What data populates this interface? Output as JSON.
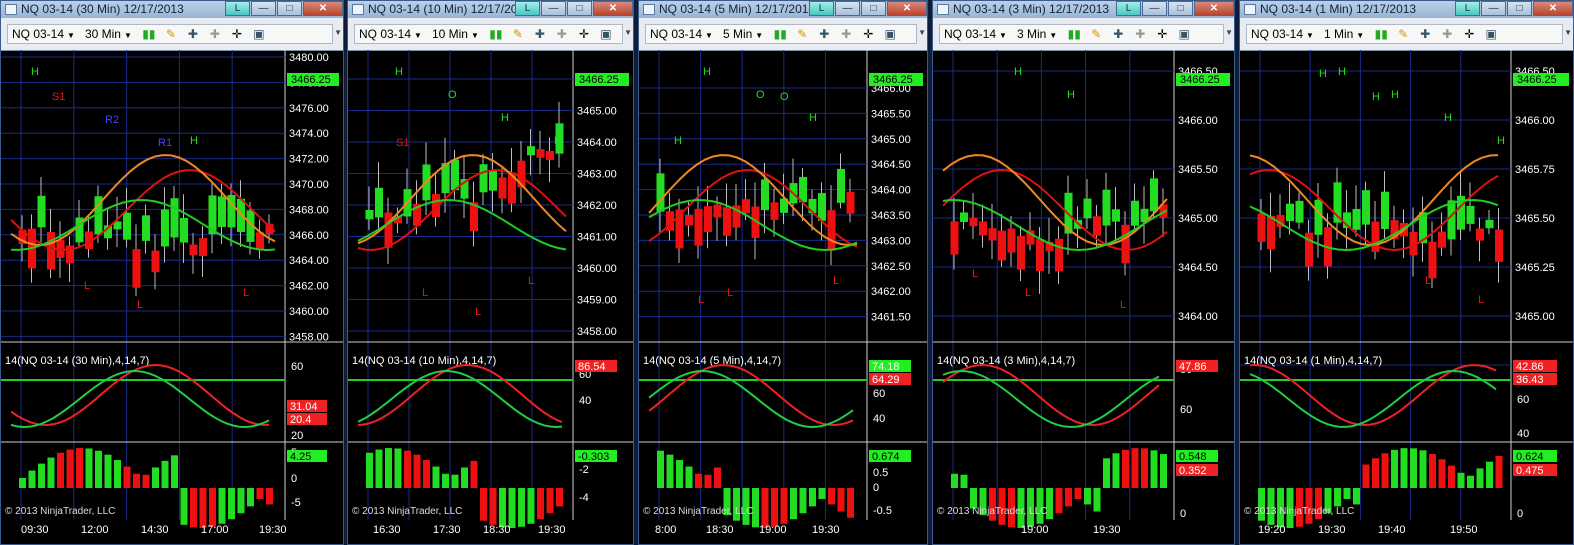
{
  "windows": [
    {
      "title": "NQ 03-14 (30 Min)  12/17/2013",
      "instrument": "NQ 03-14",
      "interval": "30 Min",
      "price_ticks": [
        "3480.00",
        "3478.00",
        "3476.00",
        "3474.00",
        "3472.00",
        "3470.00",
        "3468.00",
        "3466.00",
        "3464.00",
        "3462.00",
        "3460.00",
        "3458.00"
      ],
      "price_marker": "3466.25",
      "stoch_label": "14(NQ 03-14 (30 Min),4,14,7)",
      "stoch_ticks": [
        "60",
        "40",
        "20"
      ],
      "stoch_markers": [
        "31.04",
        "20.4"
      ],
      "macd_ticks": [
        "5",
        "0",
        "-5"
      ],
      "macd_marker": "4.25",
      "copyright": "© 2013 NinjaTrader, LLC",
      "time_ticks": [
        "09:30",
        "12:00",
        "14:30",
        "17:00",
        "19:30"
      ],
      "annotations": [
        "H",
        "L",
        "L",
        "H",
        "L",
        "S1",
        "R2",
        "R1"
      ]
    },
    {
      "title": "NQ 03-14 (10 Min)  12/17/2013",
      "instrument": "NQ 03-14",
      "interval": "10 Min",
      "price_ticks": [
        "3466.00",
        "3465.00",
        "3464.00",
        "3463.00",
        "3462.00",
        "3461.00",
        "3460.00",
        "3459.00",
        "3458.00"
      ],
      "price_marker": "3466.25",
      "stoch_label": "14(NQ 03-14 (10 Min),4,14,7)",
      "stoch_ticks": [
        "60",
        "40"
      ],
      "stoch_markers": [
        "86.54"
      ],
      "macd_ticks": [
        "-2",
        "-4"
      ],
      "macd_marker": "-0.303",
      "copyright": "© 2013 NinjaTrader, LLC",
      "time_ticks": [
        "16:30",
        "17:30",
        "18:30",
        "19:30"
      ],
      "annotations": [
        "H",
        "O",
        "H",
        "H",
        "L",
        "L",
        "L",
        "S1"
      ]
    },
    {
      "title": "NQ 03-14 (5 Min)  12/17/2013",
      "instrument": "NQ 03-14",
      "interval": "5 Min",
      "price_ticks": [
        "3466.00",
        "3465.50",
        "3465.00",
        "3464.50",
        "3464.00",
        "3463.50",
        "3463.00",
        "3462.50",
        "3462.00",
        "3461.50"
      ],
      "price_marker": "3466.25",
      "stoch_label": "14(NQ 03-14 (5 Min),4,14,7)",
      "stoch_ticks": [
        "80",
        "60",
        "40"
      ],
      "stoch_markers": [
        "74.18",
        "64.29"
      ],
      "macd_ticks": [
        "1",
        "0.5",
        "0",
        "-0.5"
      ],
      "macd_marker": "0.674",
      "copyright": "© 2013 NinjaTrader, LLC",
      "time_ticks": [
        "8:00",
        "18:30",
        "19:00",
        "19:30"
      ],
      "annotations": [
        "H",
        "O",
        "H",
        "H",
        "L",
        "O",
        "L",
        "L"
      ]
    },
    {
      "title": "NQ 03-14 (3 Min)  12/17/2013",
      "instrument": "NQ 03-14",
      "interval": "3 Min",
      "price_ticks": [
        "3466.50",
        "3466.00",
        "3465.50",
        "3465.00",
        "3464.50",
        "3464.00"
      ],
      "price_marker": "3466.25",
      "stoch_label": "14(NQ 03-14 (3 Min),4,14,7)",
      "stoch_ticks": [
        "80",
        "60"
      ],
      "stoch_markers": [
        "47.86"
      ],
      "macd_ticks": [
        "1",
        "0"
      ],
      "macd_marker": "0.548",
      "macd_marker2": "0.352",
      "copyright": "© 2013 NinjaTrader, LLC",
      "time_ticks": [
        "19:00",
        "19:30"
      ],
      "annotations": [
        "H",
        "H",
        "L",
        "L",
        "L"
      ]
    },
    {
      "title": "NQ 03-14 (1 Min)  12/17/2013",
      "instrument": "NQ 03-14",
      "interval": "1 Min",
      "price_ticks": [
        "3466.50",
        "3466.00",
        "3465.75",
        "3465.50",
        "3465.25",
        "3465.00",
        "3464.75"
      ],
      "price_marker": "3466.25",
      "stoch_label": "14(NQ 03-14 (1 Min),4,14,7)",
      "stoch_ticks": [
        "80",
        "60",
        "40"
      ],
      "stoch_markers": [
        "42.86",
        "36.43"
      ],
      "macd_ticks": [
        "1",
        "0"
      ],
      "macd_marker": "0.624",
      "macd_marker2": "0.475",
      "copyright": "© 2013 NinjaTrader, LLC",
      "time_ticks": [
        "19:20",
        "19:30",
        "19:40",
        "19:50"
      ],
      "annotations": [
        "H",
        "H",
        "H",
        "H",
        "H",
        "H",
        "L",
        "L"
      ]
    }
  ],
  "colors": {
    "up": "#22dd22",
    "down": "#ee1111",
    "stoch_k": "#ee2222",
    "stoch_d": "#22cc44",
    "sma_orange": "#ee8822",
    "sma_red": "#dd1111",
    "sma_green": "#22cc22",
    "grid": "#1a2a8a",
    "level": "#22cc22"
  }
}
